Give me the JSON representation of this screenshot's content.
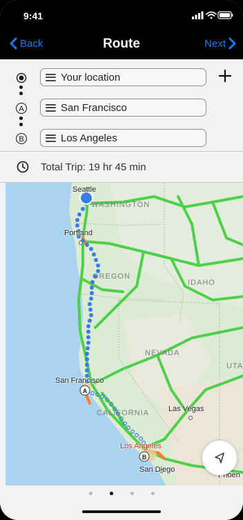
{
  "status_bar": {
    "time": "9:41",
    "icons": [
      "signal-icon",
      "wifi-icon",
      "battery-icon"
    ]
  },
  "nav": {
    "back_label": "Back",
    "title": "Route",
    "next_label": "Next",
    "accent": "#1e7af0"
  },
  "route": {
    "stops": [
      {
        "marker": "current-location",
        "value": "Your location"
      },
      {
        "marker": "A",
        "value": "San Francisco"
      },
      {
        "marker": "B",
        "value": "Los Angeles"
      }
    ],
    "add_icon": "plus-icon"
  },
  "trip": {
    "icon": "clock-icon",
    "text": "Total Trip: 19 hr 45 min"
  },
  "map": {
    "state_labels": [
      "WASHINGTON",
      "OREGON",
      "IDAHO",
      "NEVADA",
      "CALIFORNIA",
      "UTA"
    ],
    "city_labels": [
      "Seattle",
      "Portland",
      "San Francisco",
      "Las Vegas",
      "Los Angeles",
      "San Diego",
      "Phoen"
    ],
    "route_color": "#3b7de8",
    "highway_color": "#4fd04a",
    "origin_marker": "A",
    "destination_marker": "B",
    "locate_icon": "navigation-arrow-icon"
  },
  "pager": {
    "pages": 4,
    "active": 1
  }
}
